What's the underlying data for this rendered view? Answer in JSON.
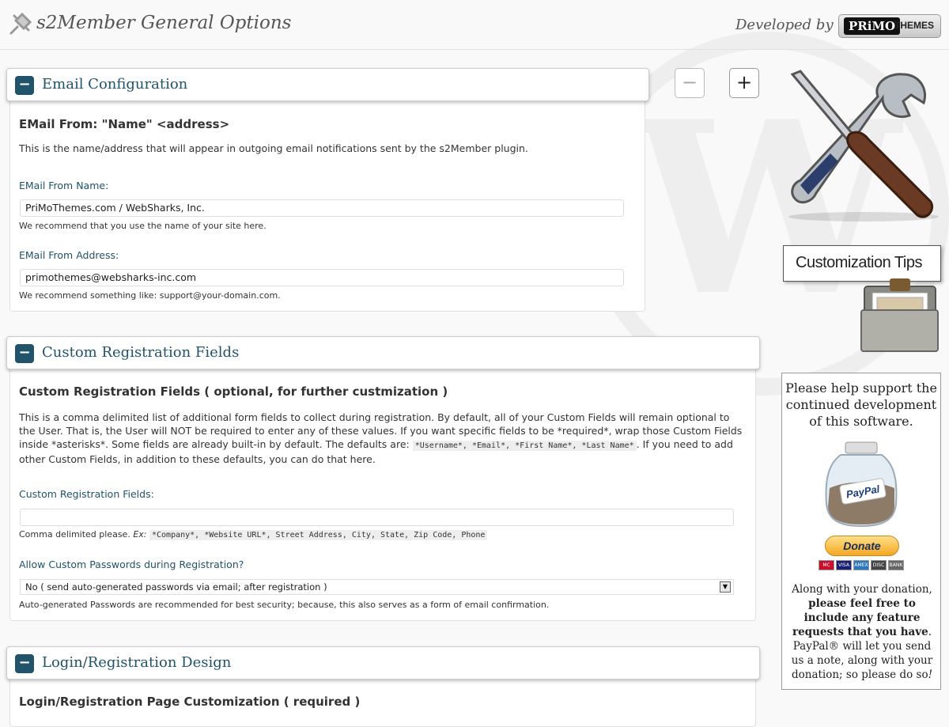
{
  "header": {
    "title": "s2Member General Options",
    "developed_by": "Developed by",
    "logo_a": "PRiMO",
    "logo_b": "THEMES"
  },
  "controls": {
    "collapse_all": "−",
    "expand_all": "+"
  },
  "sections": [
    {
      "toggle": "−",
      "title": "Email Configuration",
      "heading": "EMail From: \"Name\" <address>",
      "description": "This is the name/address that will appear in outgoing email notifications sent by the s2Member plugin.",
      "from_name_label": "EMail From Name:",
      "from_name_value": "PriMoThemes.com / WebSharks, Inc.",
      "from_name_note": "We recommend that you use the name of your site here.",
      "from_address_label": "EMail From Address:",
      "from_address_value": "primothemes@websharks-inc.com",
      "from_address_note": "We recommend something like: support@your-domain.com."
    },
    {
      "toggle": "−",
      "title": "Custom Registration Fields",
      "heading": "Custom Registration Fields ( optional, for further custmization )",
      "desc_part1": "This is a comma delimited list of additional form fields to collect during registration. By default, all of your Custom Fields will remain optional to the User. That is, the User will NOT be required to enter any of these values. If you want specific fields to be *required*, wrap those Custom Fields inside *asterisks*. Some fields are already built-in by default. The defaults are:",
      "desc_defaults": "*Username*, *Email*, *First Name*, *Last Name*",
      "desc_part2": ". If you need to add other Custom Fields, in addition to these defaults, you can do that here.",
      "fields_label": "Custom Registration Fields:",
      "fields_value": "",
      "fields_note_prefix": "Comma delimited please.",
      "fields_note_ex": "Ex:",
      "fields_note_code": "*Company*, *Website URL*, Street Address, City, State, Zip Code, Phone",
      "passwords_label": "Allow Custom Passwords during Registration?",
      "passwords_selected": "No ( send auto-generated passwords via email; after registration )",
      "passwords_note": "Auto-generated Passwords are recommended for best security; because, this also serves as a form of email confirmation."
    },
    {
      "toggle": "−",
      "title": "Login/Registration Design",
      "heading": "Login/Registration Page Customization ( required )"
    }
  ],
  "sidebar": {
    "tips_title": "Customization Tips",
    "support_lead": "Please help support the continued development of this software.",
    "jar_label": "PayPal",
    "donate_label": "Donate",
    "cards": [
      "MC",
      "VISA",
      "AMEX",
      "DISC",
      "BANK"
    ],
    "text_1": "Along with your donation,",
    "text_bold": "please feel free to include any feature requests that you have",
    "text_2": ". PayPal® will let you send us a note, along with your donation; so please do so",
    "text_end": "!"
  },
  "colors": {
    "accent": "#21536a",
    "background": "#f9f9f9"
  }
}
